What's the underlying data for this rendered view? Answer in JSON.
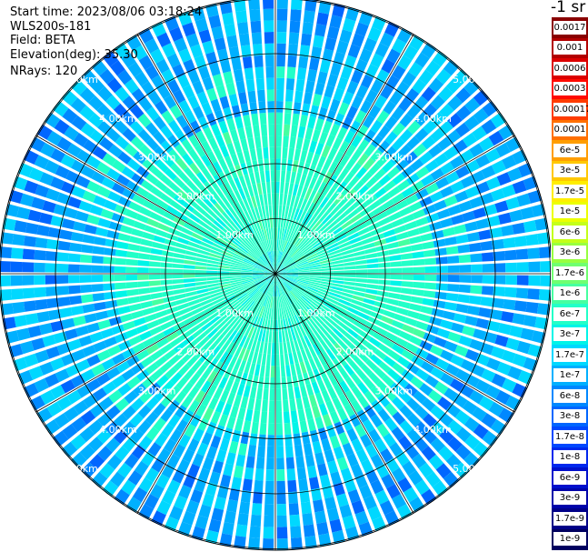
{
  "header": {
    "start_time": "Start time: 2023/08/06 03:18:24",
    "instrument": "WLS200s-181",
    "field": "Field: BETA",
    "elevation": "Elevation(deg): 35.30",
    "nrays": "NRays: 120"
  },
  "colorbar": {
    "unit": "-1 sr",
    "ticks": [
      "0.0017",
      "0.001",
      "0.0006",
      "0.0003",
      "0.00017",
      "0.0001",
      "6e-5",
      "3e-5",
      "1.7e-5",
      "1e-5",
      "6e-6",
      "3e-6",
      "1.7e-6",
      "1e-6",
      "6e-7",
      "3e-7",
      "1.7e-7",
      "1e-7",
      "6e-8",
      "3e-8",
      "1.7e-8",
      "1e-8",
      "6e-9",
      "3e-9",
      "1.7e-9",
      "1e-9"
    ],
    "colors": [
      "#8a0000",
      "#b20000",
      "#dc0000",
      "#ff0a00",
      "#ff3c00",
      "#ff7000",
      "#ff9e00",
      "#ffc800",
      "#ffee00",
      "#ecff00",
      "#c4ff1a",
      "#98ff40",
      "#70ff70",
      "#46ffa0",
      "#22ffc8",
      "#00f4e8",
      "#00d8ff",
      "#00b0ff",
      "#0088ff",
      "#0066ff",
      "#0048ff",
      "#0028ee",
      "#0010cc",
      "#0004aa",
      "#000088",
      "#000060"
    ]
  },
  "chart_data": {
    "type": "heatmap",
    "projection": "polar (PPI scan)",
    "field": "BETA",
    "n_rays": 120,
    "elevation_deg": 35.3,
    "range_rings": [
      "1.00km",
      "2.00km",
      "3.00km",
      "4.00km",
      "5.00km"
    ],
    "range_values_km": [
      1,
      2,
      3,
      4,
      5
    ],
    "max_range_km": 5.0,
    "spoke_step_deg": 30,
    "value_scale": "log",
    "value_range": [
      1e-09,
      0.0017
    ],
    "typical_values": [
      {
        "range_km": [
          0,
          0.5
        ],
        "beta": "1.7e-7 to 3e-7"
      },
      {
        "range_km": [
          0.5,
          3.0
        ],
        "beta": "about 3e-7"
      },
      {
        "range_km": [
          3.0,
          5.0
        ],
        "beta": "1e-7 to 1.7e-8"
      }
    ]
  }
}
